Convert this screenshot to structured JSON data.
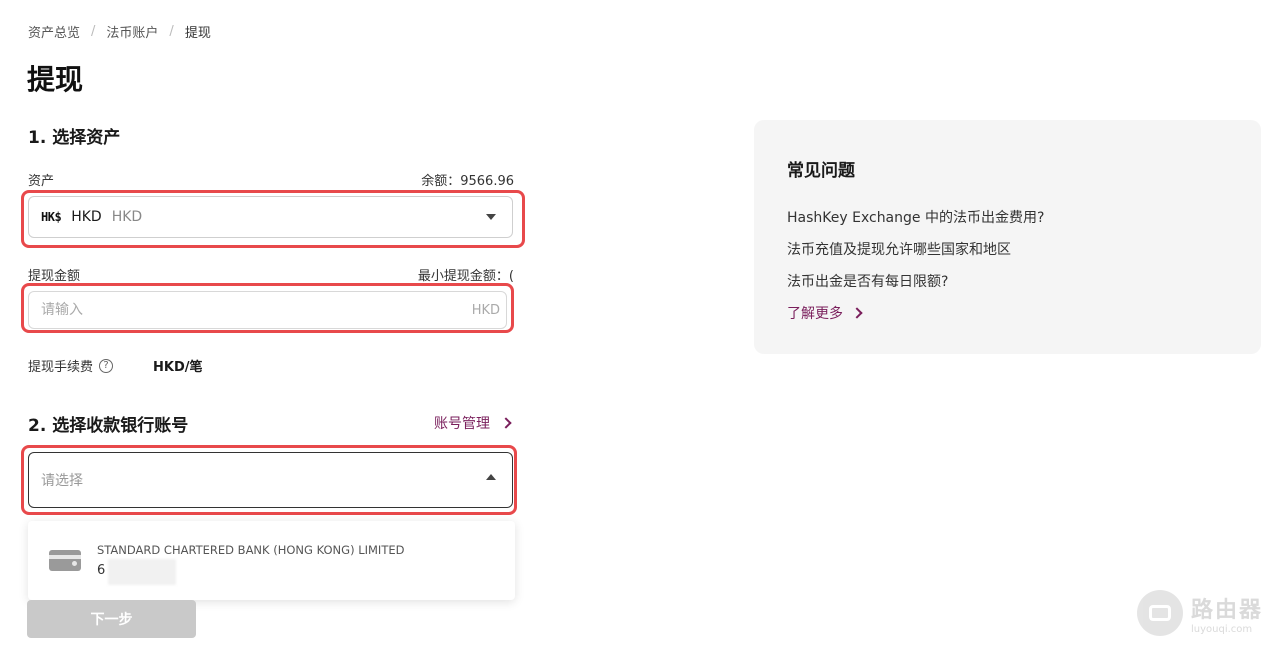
{
  "breadcrumb": {
    "items": [
      "资产总览",
      "法币账户",
      "提现"
    ],
    "separator": "/"
  },
  "page_title": "提现",
  "section1": {
    "title": "1. 选择资产",
    "asset_label": "资产",
    "balance_text": "余额：9566.96",
    "asset_logo": "HK$",
    "asset_code": "HKD",
    "asset_name": "HKD"
  },
  "amount": {
    "label": "提现金额",
    "min_text": "最小提现金额：(",
    "placeholder": "请输入",
    "unit": "HKD"
  },
  "fee": {
    "label": "提现手续费",
    "help_glyph": "?",
    "unit": "HKD/笔"
  },
  "section2": {
    "title": "2. 选择收款银行账号",
    "manage_label": "账号管理",
    "select_placeholder": "请选择"
  },
  "bank_option": {
    "icon": "bank-card-icon",
    "name": "STANDARD CHARTERED BANK (HONG KONG) LIMITED",
    "account": "6"
  },
  "next_button": "下一步",
  "faq": {
    "title": "常见问题",
    "items": [
      "HashKey Exchange 中的法币出金费用?",
      "法币充值及提现允许哪些国家和地区",
      "法币出金是否有每日限额?"
    ],
    "learn_more": "了解更多"
  },
  "watermark": {
    "main": "路由器",
    "sub": "luyouqi.com"
  },
  "colors": {
    "accent": "#7a1f5c",
    "highlight": "#e8494b",
    "button_disabled": "#c9c9c9",
    "faq_bg": "#f5f5f5"
  }
}
